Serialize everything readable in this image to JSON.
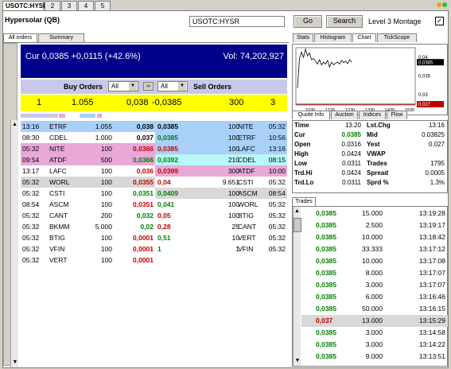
{
  "top_tabs": [
    {
      "label": "USOTC:HYSR"
    },
    {
      "label": "2"
    },
    {
      "label": "3"
    },
    {
      "label": "4"
    },
    {
      "label": "5"
    }
  ],
  "header": {
    "title": "Hypersolar (QB)",
    "symbol_value": "USOTC:HYSR",
    "go_label": "Go",
    "search_label": "Search",
    "level3_label": "Level 3 Montage",
    "level3_checked": true
  },
  "left_tabs": [
    {
      "label": "All orders"
    },
    {
      "label": "Summary"
    }
  ],
  "right_tabs": [
    {
      "label": "Stats"
    },
    {
      "label": "Histogram"
    },
    {
      "label": "Chart"
    },
    {
      "label": "TickScope"
    }
  ],
  "summary": {
    "cur_text": "Cur 0,0385 +0,0115 (+42.6%)",
    "vol_text": "Vol: 74,202,927"
  },
  "order_filter": {
    "buy_label": "Buy Orders",
    "buy_select": "All",
    "sell_select": "All",
    "sell_label": "Sell Orders"
  },
  "bid_ask": {
    "bid_count": "1",
    "bid_size": "1.055",
    "bid_price": "0,038",
    "ask_price": "-0,0385",
    "ask_size": "300",
    "ask_count": "3"
  },
  "buy_orders": [
    {
      "time": "13:16",
      "mm": "ETRF",
      "size": "1.055",
      "price": "0,038",
      "color": "#a8d0f8",
      "pc": "b"
    },
    {
      "time": "08:30",
      "mm": "CDEL",
      "size": "1.000",
      "price": "0,037",
      "color": "#ffffff",
      "pc": "b"
    },
    {
      "time": "05:32",
      "mm": "NITE",
      "size": "100",
      "price": "0,0366",
      "color": "#e8a8d8",
      "pc": "red"
    },
    {
      "time": "09:54",
      "mm": "ATDF",
      "size": "500",
      "price": "0,0366",
      "color": "#e8a8d8",
      "pc": "grn"
    },
    {
      "time": "13:17",
      "mm": "LAFC",
      "size": "100",
      "price": "0,036",
      "color": "#ffffff",
      "pc": "red"
    },
    {
      "time": "05:32",
      "mm": "WORL",
      "size": "100",
      "price": "0,0355",
      "color": "#d8d8d8",
      "pc": "red"
    },
    {
      "time": "05:32",
      "mm": "CSTI",
      "size": "100",
      "price": "0,0351",
      "color": "#ffffff",
      "pc": "grn"
    },
    {
      "time": "08:54",
      "mm": "ASCM",
      "size": "100",
      "price": "0,0351",
      "color": "#ffffff",
      "pc": "red"
    },
    {
      "time": "05:32",
      "mm": "CANT",
      "size": "200",
      "price": "0,032",
      "color": "#ffffff",
      "pc": "grn"
    },
    {
      "time": "05:32",
      "mm": "BKMM",
      "size": "5.000",
      "price": "0,02",
      "color": "#ffffff",
      "pc": "grn"
    },
    {
      "time": "05:32",
      "mm": "BTIG",
      "size": "100",
      "price": "0,0001",
      "color": "#ffffff",
      "pc": "red"
    },
    {
      "time": "05:32",
      "mm": "VFIN",
      "size": "100",
      "price": "0,0001",
      "color": "#ffffff",
      "pc": "red"
    },
    {
      "time": "05:32",
      "mm": "VERT",
      "size": "100",
      "price": "0,0001",
      "color": "#ffffff",
      "pc": "red"
    }
  ],
  "sell_orders": [
    {
      "price": "0,0385",
      "size": "100",
      "mm": "NITE",
      "time": "05:32",
      "color": "#a8d0f8",
      "pc": "b"
    },
    {
      "price": "0,0385",
      "size": "100",
      "mm": "ETRF",
      "time": "10:56",
      "color": "#a8d0f8",
      "pc": "grn"
    },
    {
      "price": "0,0385",
      "size": "100",
      "mm": "LAFC",
      "time": "13:16",
      "color": "#a8d0f8",
      "pc": "red"
    },
    {
      "price": "0,0392",
      "size": "210",
      "mm": "CDEL",
      "time": "08:15",
      "color": "#b8f8f8",
      "pc": "grn"
    },
    {
      "price": "0,0399",
      "size": "300",
      "mm": "ATDF",
      "time": "10:00",
      "color": "#e8a8d8",
      "pc": "red"
    },
    {
      "price": "0,04",
      "size": "9.651",
      "mm": "CSTI",
      "time": "05:32",
      "color": "#ffffff",
      "pc": "red"
    },
    {
      "price": "0,0409",
      "size": "100",
      "mm": "ASCM",
      "time": "08:54",
      "color": "#d8d8d8",
      "pc": "grn"
    },
    {
      "price": "0,041",
      "size": "100",
      "mm": "WORL",
      "time": "05:32",
      "color": "#ffffff",
      "pc": "grn"
    },
    {
      "price": "0,05",
      "size": "100",
      "mm": "BTIG",
      "time": "05:32",
      "color": "#ffffff",
      "pc": "red"
    },
    {
      "price": "0,28",
      "size": "25",
      "mm": "CANT",
      "time": "05:32",
      "color": "#ffffff",
      "pc": "red"
    },
    {
      "price": "0,51",
      "size": "10",
      "mm": "VERT",
      "time": "05:32",
      "color": "#ffffff",
      "pc": "grn"
    },
    {
      "price": "1",
      "size": "1",
      "mm": "VFIN",
      "time": "05:32",
      "color": "#ffffff",
      "pc": "grn"
    }
  ],
  "chart_data": {
    "type": "line",
    "x_ticks": [
      "1030",
      "1130",
      "1230",
      "1330",
      "1430",
      "1530"
    ],
    "y_ticks": [
      "0,04",
      "0,035",
      "0,03"
    ],
    "last_label": "0,0385",
    "low_label": "0,027",
    "ylim": [
      0.027,
      0.0424
    ]
  },
  "quote_tabs": [
    {
      "label": "Quote Info"
    },
    {
      "label": "Auction"
    },
    {
      "label": "Indices"
    },
    {
      "label": "Flow"
    }
  ],
  "quote": [
    {
      "l": "Time",
      "v": "13:20",
      "l2": "Lst.Chg",
      "v2": "13:16"
    },
    {
      "l": "Cur",
      "v": "0.0385",
      "l2": "Mid",
      "v2": "0.03825"
    },
    {
      "l": "Open",
      "v": "0.0316",
      "l2": "Yest",
      "v2": "0.027"
    },
    {
      "l": "High",
      "v": "0.0424",
      "l2": "VWAP",
      "v2": ""
    },
    {
      "l": "Low",
      "v": "0.0311",
      "l2": "Trades",
      "v2": "1795"
    },
    {
      "l": "Trd.Hi",
      "v": "0.0424",
      "l2": "Spread",
      "v2": "0.0005"
    },
    {
      "l": "Trd.Lo",
      "v": "0.0311",
      "l2": "Sprd %",
      "v2": "1.3%"
    }
  ],
  "trades_tab": "Trades",
  "trades": [
    {
      "p": "0,0385",
      "s": "15.000",
      "t": "13:19:28",
      "c": "grn"
    },
    {
      "p": "0,0385",
      "s": "2.500",
      "t": "13:19:17",
      "c": "grn"
    },
    {
      "p": "0,0385",
      "s": "10.000",
      "t": "13:18:42",
      "c": "grn"
    },
    {
      "p": "0,0385",
      "s": "33.333",
      "t": "13:17:12",
      "c": "grn"
    },
    {
      "p": "0,0385",
      "s": "10.000",
      "t": "13:17:08",
      "c": "grn"
    },
    {
      "p": "0,0385",
      "s": "8.000",
      "t": "13:17:07",
      "c": "grn"
    },
    {
      "p": "0,0385",
      "s": "3.000",
      "t": "13:17:07",
      "c": "grn"
    },
    {
      "p": "0,0385",
      "s": "6.000",
      "t": "13:16:46",
      "c": "grn"
    },
    {
      "p": "0,0385",
      "s": "50.000",
      "t": "13:16:15",
      "c": "grn"
    },
    {
      "p": "0,037",
      "s": "13.000",
      "t": "13:15:29",
      "c": "red"
    },
    {
      "p": "0,0385",
      "s": "3.000",
      "t": "13:14:58",
      "c": "grn"
    },
    {
      "p": "0,0385",
      "s": "3.000",
      "t": "13:14:22",
      "c": "grn"
    },
    {
      "p": "0,0385",
      "s": "9.000",
      "t": "13:13:51",
      "c": "grn"
    }
  ]
}
